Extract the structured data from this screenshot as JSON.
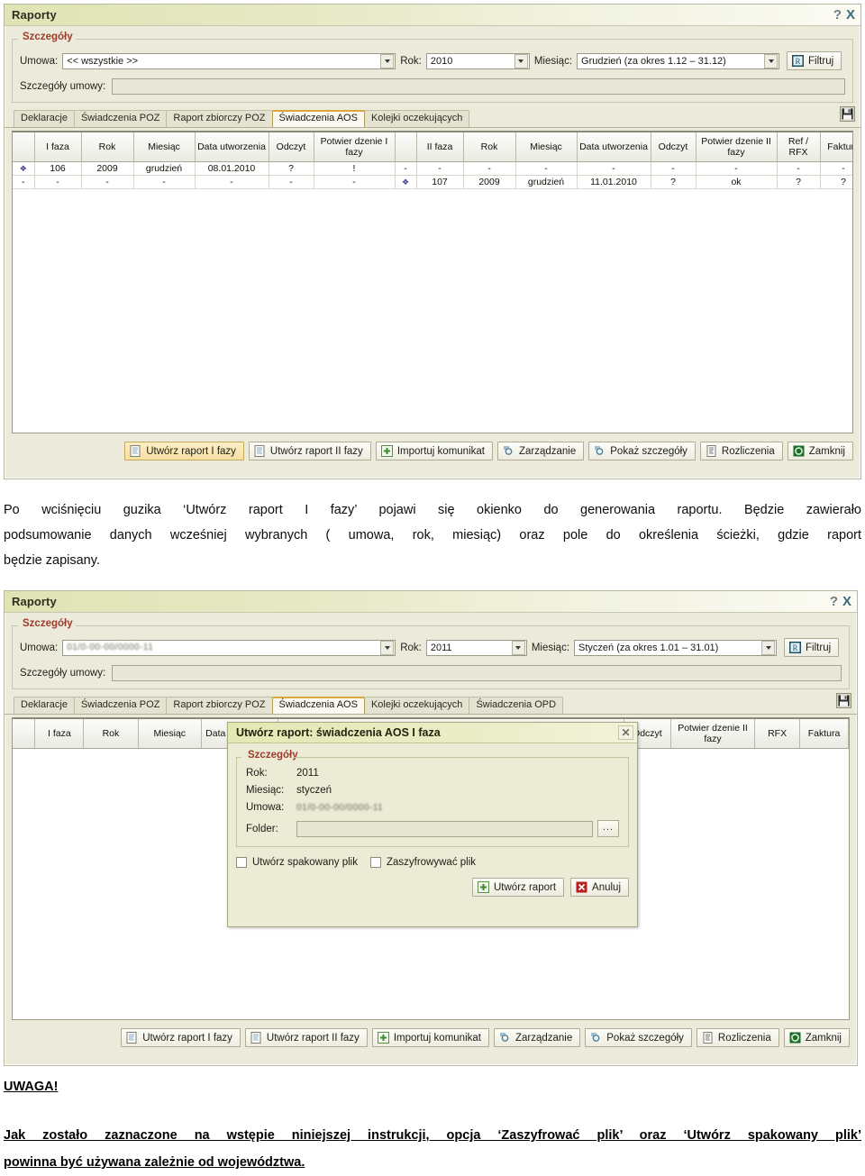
{
  "colors": {
    "title_bar_start": "#dfe4b4",
    "accent_red": "#9e3b2b",
    "active_tab_top": "#e0a43c",
    "window_bg": "#eceadb",
    "dialog_bg": "#ecebd6"
  },
  "window1": {
    "title": "Raporty",
    "help_btn": "?",
    "close_btn": "X",
    "group_label": "Szczegóły",
    "fields": {
      "umowa_label": "Umowa:",
      "umowa_value": "<< wszystkie >>",
      "rok_label": "Rok:",
      "rok_value": "2010",
      "miesiac_label": "Miesiąc:",
      "miesiac_value": "Grudzień (za okres 1.12 – 31.12)",
      "szczegoly_umowy_label": "Szczegóły umowy:",
      "szczegoly_umowy_value": ""
    },
    "filter_button": "Filtruj",
    "tabs": [
      {
        "label": "Deklaracje",
        "active": false
      },
      {
        "label": "Świadczenia POZ",
        "active": false
      },
      {
        "label": "Raport zbiorczy POZ",
        "active": false
      },
      {
        "label": "Świadczenia AOS",
        "active": true
      },
      {
        "label": "Kolejki oczekujących",
        "active": false
      }
    ],
    "save_icon": "save-icon",
    "table": {
      "headers": [
        "",
        "I faza",
        "Rok",
        "Miesiąc",
        "Data utworzenia",
        "Odczyt",
        "Potwier dzenie I fazy",
        "",
        "II faza",
        "Rok",
        "Miesiąc",
        "Data utworzenia",
        "Odczyt",
        "Potwier dzenie II fazy",
        "Ref / RFX",
        "Faktura"
      ],
      "rows": [
        [
          "❖",
          "106",
          "2009",
          "grudzień",
          "08.01.2010",
          "?",
          "!",
          "-",
          "-",
          "-",
          "-",
          "-",
          "-",
          "-",
          "-",
          "-"
        ],
        [
          "-",
          "-",
          "-",
          "-",
          "-",
          "-",
          "-",
          "❖",
          "107",
          "2009",
          "grudzień",
          "11.01.2010",
          "?",
          "ok",
          "?",
          "?"
        ]
      ]
    },
    "toolbar": [
      {
        "label": "Utwórz raport I fazy",
        "icon": "document-icon",
        "highlighted": true
      },
      {
        "label": "Utwórz raport II fazy",
        "icon": "document-icon",
        "highlighted": false
      },
      {
        "label": "Importuj komunikat",
        "icon": "plus-icon",
        "highlighted": false
      },
      {
        "label": "Zarządzanie",
        "icon": "gear-icon",
        "highlighted": false
      },
      {
        "label": "Pokaż szczegóły",
        "icon": "details-icon",
        "highlighted": false
      },
      {
        "label": "Rozliczenia",
        "icon": "list-icon",
        "highlighted": false
      },
      {
        "label": "Zamknij",
        "icon": "close-circle-icon",
        "highlighted": false
      }
    ]
  },
  "paragraph": {
    "line1": "Po wciśnięciu guzika ‘Utwórz raport I fazy’ pojawi się okienko do generowania raportu. Będzie zawierało",
    "line2": "podsumowanie danych wcześniej wybranych ( umowa, rok, miesiąc) oraz pole do określenia ścieżki, gdzie raport",
    "line3": "będzie zapisany."
  },
  "window2": {
    "title": "Raporty",
    "help_btn": "?",
    "close_btn": "X",
    "group_label": "Szczegóły",
    "fields": {
      "umowa_label": "Umowa:",
      "umowa_value": "01/0-00-00/0000-11",
      "rok_label": "Rok:",
      "rok_value": "2011",
      "miesiac_label": "Miesiąc:",
      "miesiac_value": "Styczeń (za okres 1.01 – 31.01)",
      "szczegoly_umowy_label": "Szczegóły umowy:",
      "szczegoly_umowy_value": ""
    },
    "filter_button": "Filtruj",
    "tabs": [
      {
        "label": "Deklaracje",
        "active": false
      },
      {
        "label": "Świadczenia POZ",
        "active": false
      },
      {
        "label": "Raport zbiorczy POZ",
        "active": false
      },
      {
        "label": "Świadczenia AOS",
        "active": true
      },
      {
        "label": "Kolejki oczekujących",
        "active": false
      },
      {
        "label": "Świadczenia OPD",
        "active": false
      }
    ],
    "save_icon": "save-icon",
    "table": {
      "headers_left": [
        "",
        "I faza",
        "Rok",
        "Miesiąc",
        "Data utworzenia"
      ],
      "headers_right": [
        "Odczyt",
        "Potwier dzenie II fazy",
        "RFX",
        "Faktura"
      ]
    },
    "toolbar": [
      {
        "label": "Utwórz raport I fazy",
        "icon": "document-icon",
        "highlighted": false
      },
      {
        "label": "Utwórz raport II fazy",
        "icon": "document-icon",
        "highlighted": false
      },
      {
        "label": "Importuj komunikat",
        "icon": "plus-icon",
        "highlighted": false
      },
      {
        "label": "Zarządzanie",
        "icon": "gear-icon",
        "highlighted": false
      },
      {
        "label": "Pokaż szczegóły",
        "icon": "details-icon",
        "highlighted": false
      },
      {
        "label": "Rozliczenia",
        "icon": "list-icon",
        "highlighted": false
      },
      {
        "label": "Zamknij",
        "icon": "close-circle-icon",
        "highlighted": false
      }
    ]
  },
  "dialog": {
    "title": "Utwórz raport: świadczenia AOS I faza",
    "close_btn": "✕",
    "group_label": "Szczegóły",
    "rok_label": "Rok:",
    "rok_value": "2011",
    "miesiac_label": "Miesiąc:",
    "miesiac_value": "styczeń",
    "umowa_label": "Umowa:",
    "umowa_value": "01/0-00-00/0000-11",
    "folder_label": "Folder:",
    "folder_value": "",
    "browse_button": "...",
    "checkbox_zip": "Utwórz spakowany plik",
    "checkbox_zip_checked": false,
    "checkbox_encrypt": "Zaszyfrowywać plik",
    "checkbox_encrypt_checked": false,
    "create_button": "Utwórz raport",
    "cancel_button": "Anuluj"
  },
  "note": {
    "heading": "UWAGA!",
    "line1": "Jak zostało zaznaczone na wstępie niniejszej instrukcji, opcja ‘Zaszyfrować plik’ oraz ‘Utwórz spakowany plik’",
    "line2": "powinna być używana zależnie od województwa."
  }
}
